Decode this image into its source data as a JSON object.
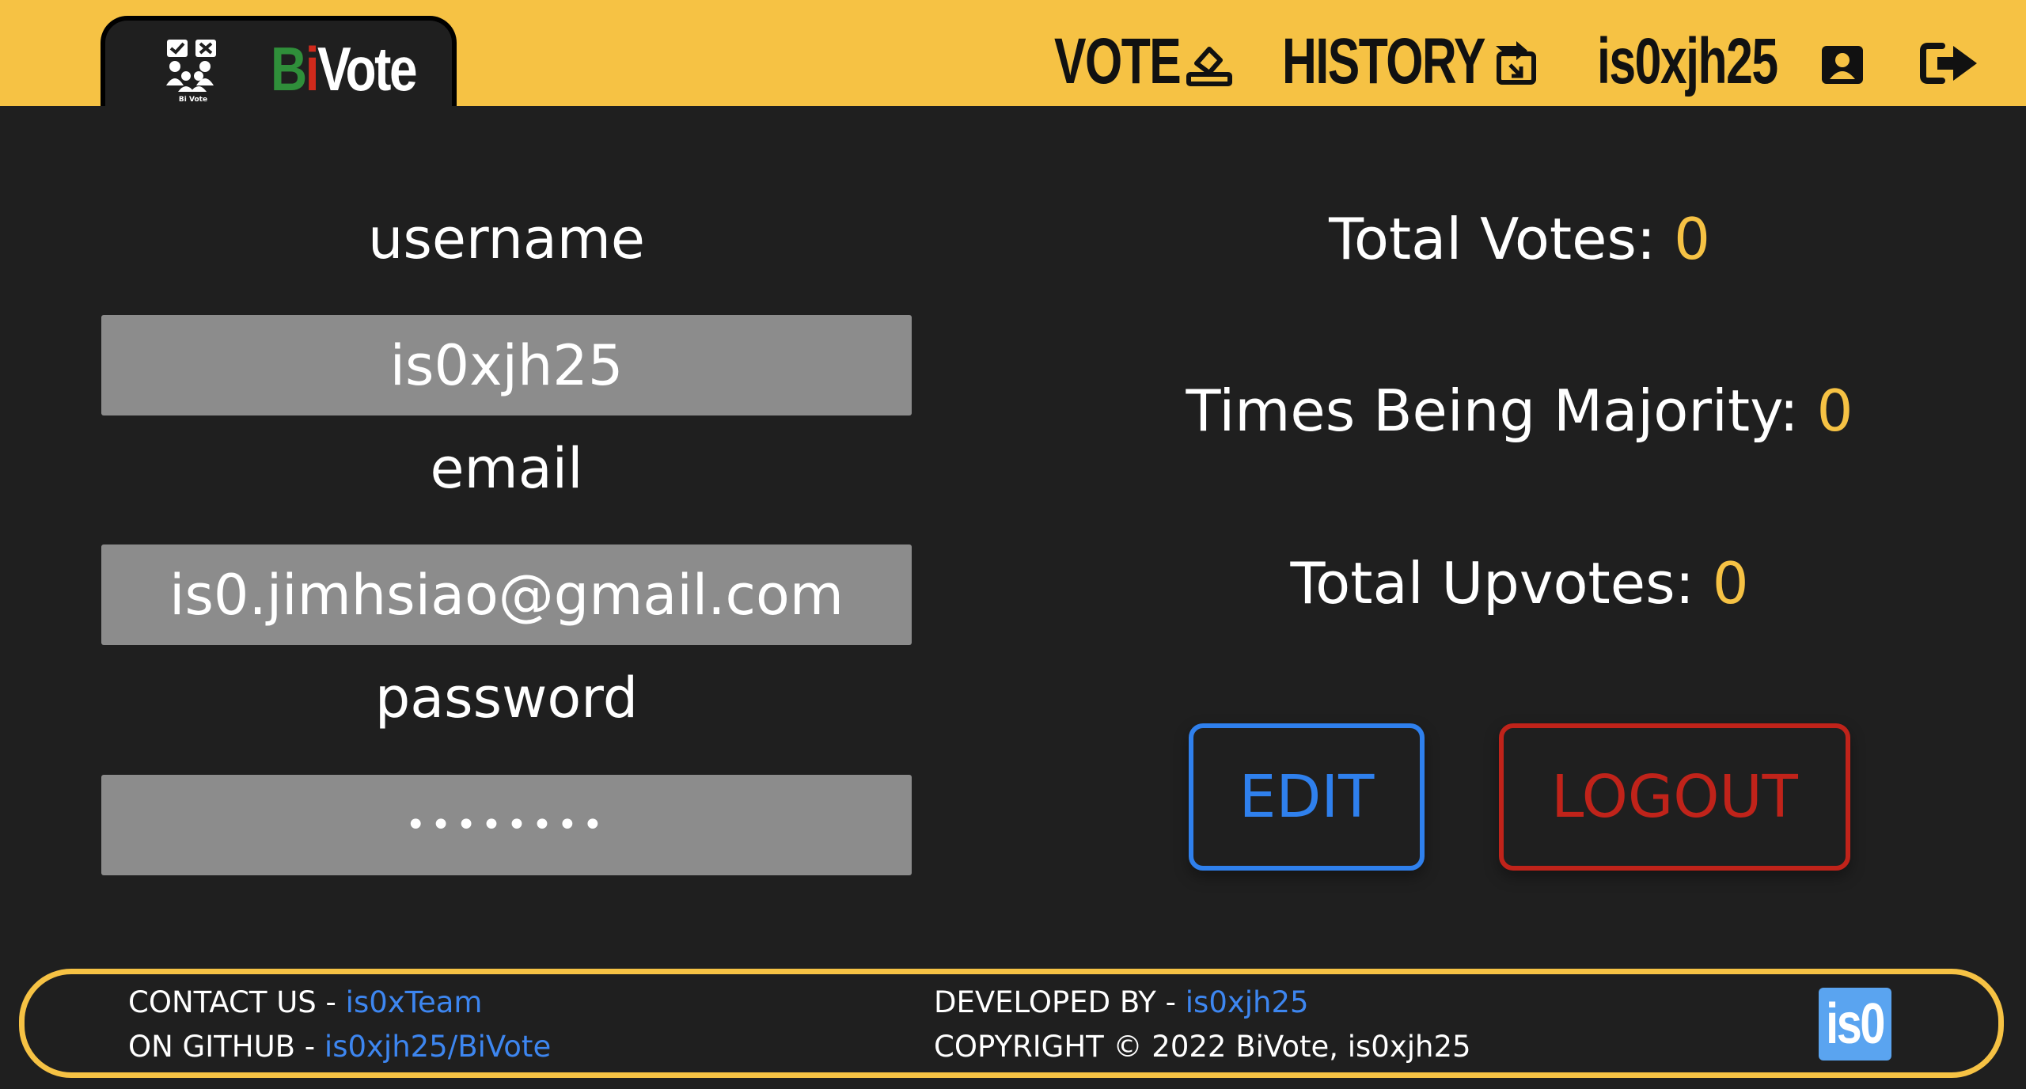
{
  "brand": {
    "letter_b": "B",
    "letter_i": "i",
    "rest": "Vote",
    "logo_caption": "Bi Vote"
  },
  "nav": {
    "vote_label": "VOTE",
    "history_label": "HISTORY",
    "user_label": "is0xjh25",
    "icons": [
      "ballot-box-icon",
      "history-share-icon",
      "user-icon",
      "sign-out-icon"
    ]
  },
  "profile": {
    "username_label": "username",
    "username_value": "is0xjh25",
    "email_label": "email",
    "email_value": "is0.jimhsiao@gmail.com",
    "password_label": "password",
    "password_value": "••••••••"
  },
  "stats": {
    "total_votes_label": "Total Votes: ",
    "total_votes_value": "0",
    "majority_label": "Times Being Majority: ",
    "majority_value": "0",
    "upvotes_label": "Total Upvotes: ",
    "upvotes_value": "0"
  },
  "actions": {
    "edit_label": "EDIT",
    "logout_label": "LOGOUT"
  },
  "footer": {
    "contact_prefix": "CONTACT US - ",
    "contact_link": "is0xTeam",
    "github_prefix": "ON GITHUB - ",
    "github_link": "is0xjh25/BiVote",
    "developed_prefix": "DEVELOPED BY - ",
    "developed_link": "is0xjh25",
    "copyright": "COPYRIGHT © 2022 BiVote, is0xjh25",
    "logo_text": "is0"
  },
  "colors": {
    "header_yellow": "#f6c244",
    "background": "#1f1f1f",
    "input_gray": "#8c8c8c",
    "edit_blue": "#2f80ed",
    "logout_red": "#c0231a",
    "link_blue": "#3d86f0"
  }
}
